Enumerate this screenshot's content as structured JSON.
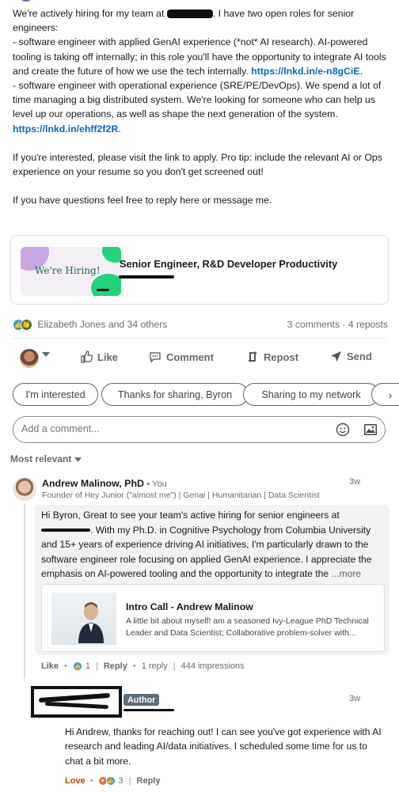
{
  "post": {
    "line1_a": "We're actively hiring for my team at",
    "line1_b": ". I have two open roles for senior",
    "line2": "engineers:",
    "role1_text": "- software engineer with applied GenAI experience (*not* AI research). AI-powered tooling is taking off internally; in this role you'll have the opportunity to integrate AI tools and create the future of how we use the tech internally.",
    "role1_link": "https://lnkd.in/e-n8gCiE",
    "role1_end": ".",
    "role2_text": "- software engineer with operational experience (SRE/PE/DevOps). We spend a lot of time managing a big distributed system. We're looking for someone who can help us level up our operations, as well as shape the next generation of the system.",
    "role2_link": "https://lnkd.in/ehff2f2R",
    "role2_end": ".",
    "para2": "If you're interested, please visit the link to apply. Pro tip: include the relevant AI or Ops experience on your resume so you don't get screened out!",
    "para3": "If you have questions feel free to reply here or message me."
  },
  "job_card": {
    "thumb_text": "We're Hiring!",
    "title": "Senior Engineer, R&D Developer Productivity"
  },
  "social": {
    "reactors": "Elizabeth Jones and 34 others",
    "counts": "3 comments · 4 reposts"
  },
  "actions": {
    "like": "Like",
    "comment": "Comment",
    "repost": "Repost",
    "send": "Send"
  },
  "chips": [
    "I'm interested",
    "Thanks for sharing, Byron",
    "Sharing to my network"
  ],
  "comment_input": {
    "placeholder": "Add a comment..."
  },
  "sort": {
    "label": "Most relevant"
  },
  "comment": {
    "author": "Andrew Malinow, PhD",
    "you": "• You",
    "headline": "Founder of Hey Junior (\"almost me\") | Genai | Humanitarian | Data Scientist",
    "time": "3w",
    "text_a": "Hi Byron, Great to see your team's active hiring for senior engineers at",
    "text_b": ". With my Ph.D. in Cognitive Psychology from Columbia University and 15+ years of experience driving AI initiatives, I'm particularly drawn to the software engineer role focusing on applied GenAI experience. I appreciate the emphasis on AI-powered tooling and the opportunity to integrate the",
    "more": "...more",
    "link_card": {
      "title": "Intro Call - Andrew Malinow",
      "desc": "A little bit about myself! am a seasoned Ivy-League PhD Technical Leader and Data Scientist; Collaborative problem-solver with..."
    },
    "like_label": "Like",
    "like_count": "1",
    "reply_label": "Reply",
    "replies": "1 reply",
    "impressions": "444 impressions"
  },
  "reply": {
    "badge": "Author",
    "time": "3w",
    "text": "Hi Andrew, thanks for reaching out! I can see you've got experience with AI research and leading AI/data initiatives. I scheduled some time for us to chat a bit more.",
    "love_label": "Love",
    "reaction_count": "3",
    "reply_label": "Reply"
  },
  "colors": {
    "link": "#0a66c2",
    "like_blue": "#378fe9",
    "author_badge": "#5e6d7a",
    "love": "#c2410c"
  }
}
